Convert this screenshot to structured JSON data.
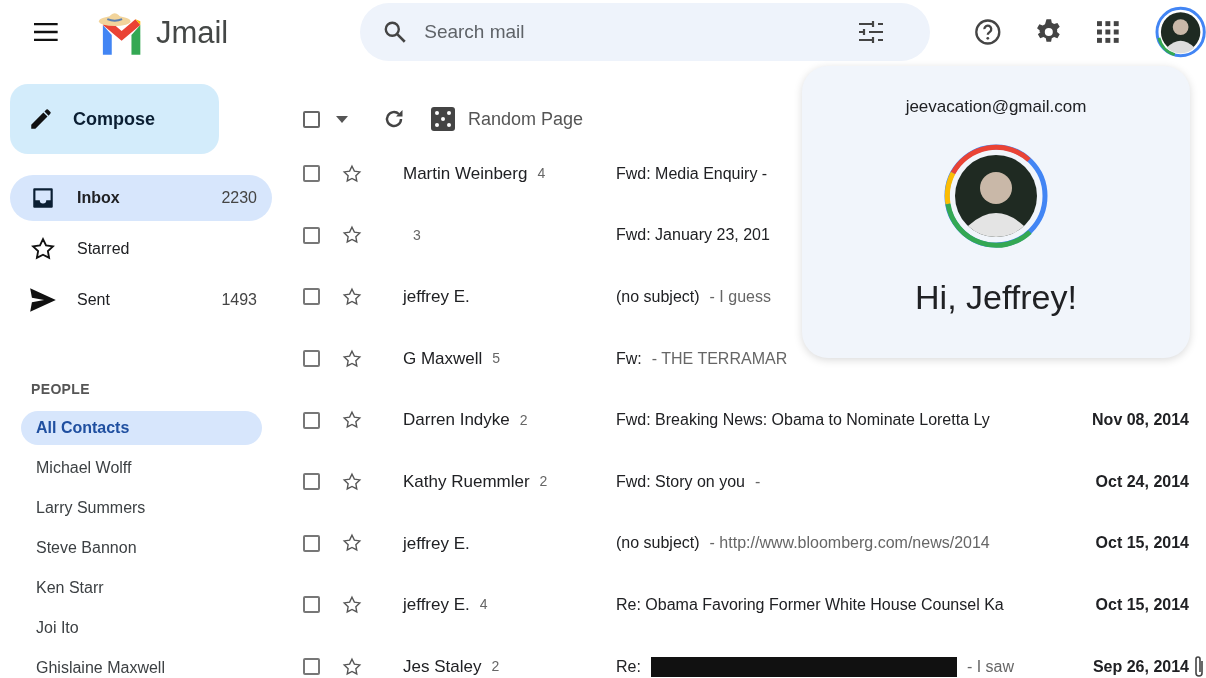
{
  "header": {
    "app_name": "Jmail",
    "search": {
      "placeholder": "Search mail"
    }
  },
  "compose": {
    "label": "Compose"
  },
  "folders": [
    {
      "kind": "inbox",
      "label": "Inbox",
      "count": "2230",
      "selected": true
    },
    {
      "kind": "starred",
      "label": "Starred",
      "selected": false
    },
    {
      "kind": "sent",
      "label": "Sent",
      "count": "1493",
      "selected": false
    }
  ],
  "people": {
    "heading": "PEOPLE",
    "items": [
      {
        "label": "All Contacts",
        "selected": true
      },
      {
        "label": "Michael Wolff",
        "selected": false
      },
      {
        "label": "Larry Summers",
        "selected": false
      },
      {
        "label": "Steve Bannon",
        "selected": false
      },
      {
        "label": "Ken Starr",
        "selected": false
      },
      {
        "label": "Joi Ito",
        "selected": false
      },
      {
        "label": "Ghislaine Maxwell",
        "selected": false
      }
    ]
  },
  "toolbar": {
    "select_all": {
      "checked": false
    },
    "random_label": "Random Page"
  },
  "emails": [
    {
      "sender": "Martin Weinberg",
      "count": "4",
      "subject": "Fwd: Media Enquiry -",
      "checked": false,
      "starred": false,
      "redacted": false,
      "attachment": false
    },
    {
      "count": "3",
      "subject": "Fwd: January 23, 201",
      "checked": false,
      "starred": false,
      "redacted": false,
      "attachment": false
    },
    {
      "sender": "jeffrey E.",
      "subject": "(no subject)",
      "snippet": "- I guess",
      "checked": false,
      "starred": false,
      "redacted": false,
      "attachment": false
    },
    {
      "sender": "G Maxwell",
      "count": "5",
      "subject": "Fw:",
      "snippet": "- THE TERRAMAR",
      "checked": false,
      "starred": false,
      "redacted": false,
      "attachment": false
    },
    {
      "sender": "Darren Indyke",
      "count": "2",
      "subject": "Fwd: Breaking News: Obama to Nominate Loretta Ly",
      "date": "Nov 08, 2014",
      "checked": false,
      "starred": false,
      "redacted": false,
      "attachment": false
    },
    {
      "sender": "Kathy Ruemmler",
      "count": "2",
      "subject": "Fwd: Story on you",
      "snippet": "-",
      "date": "Oct 24, 2014",
      "checked": false,
      "starred": false,
      "redacted": false,
      "attachment": false
    },
    {
      "sender": "jeffrey E.",
      "subject": "(no subject)",
      "snippet": "- http://www.bloomberg.com/news/2014",
      "date": "Oct 15, 2014",
      "checked": false,
      "starred": false,
      "redacted": false,
      "attachment": false
    },
    {
      "sender": "jeffrey E.",
      "count": "4",
      "subject": "Re: Obama Favoring Former White House Counsel Ka",
      "date": "Oct 15, 2014",
      "checked": false,
      "starred": false,
      "redacted": false,
      "attachment": false
    },
    {
      "sender": "Jes Staley",
      "count": "2",
      "subject": "Re:",
      "snippet": "- I saw",
      "date": "Sep 26, 2014",
      "checked": false,
      "starred": false,
      "redacted": true,
      "attachment": true
    }
  ],
  "account_popup": {
    "email": "jeevacation@gmail.com",
    "greeting": "Hi, Jeffrey!"
  }
}
